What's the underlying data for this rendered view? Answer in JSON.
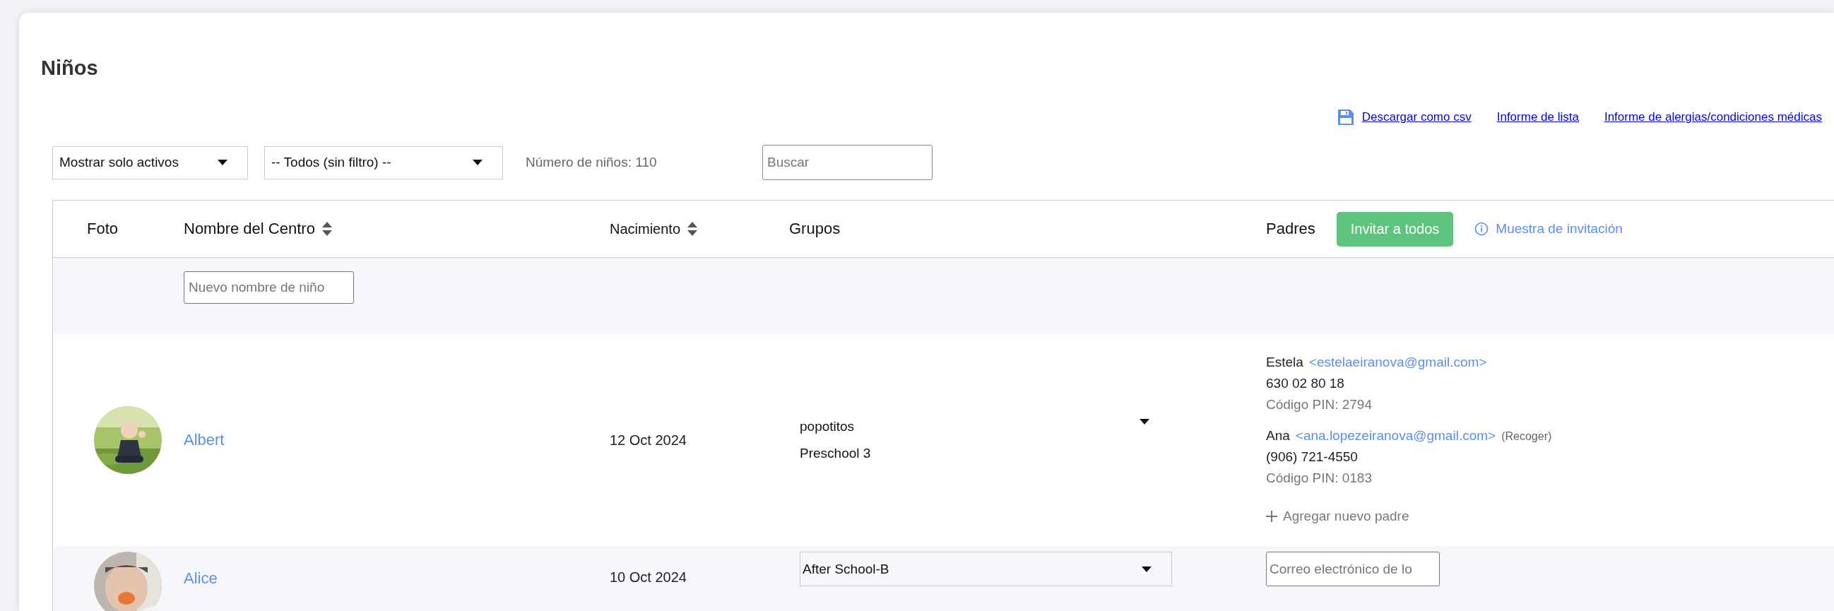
{
  "title": "Niños",
  "links": [
    {
      "label": "Descargar como csv"
    },
    {
      "label": "Informe de lista"
    },
    {
      "label": "Informe de alergias/condiciones médicas"
    }
  ],
  "filters": {
    "status_select": "Mostrar solo activos",
    "group_select": "-- Todos (sin filtro) --",
    "count": "Número de niños: 110",
    "search": {
      "placeholder": "Buscar"
    }
  },
  "table": {
    "columns": [
      {
        "label": "Foto",
        "sortable": false
      },
      {
        "label": "Nombre del Centro",
        "sortable": true
      },
      {
        "label": "Nacimiento",
        "sortable": true
      },
      {
        "label": "Grupos",
        "sortable": false
      },
      {
        "label": "Padres",
        "sortable": false
      }
    ],
    "invite_button": "Invitar a todos",
    "invite_sample": "Muestra de invitación",
    "new_child": {
      "placeholder": "Nuevo nombre de niño"
    },
    "rows": [
      {
        "name": "Albert",
        "birth": "12 Oct 2024",
        "groups": {
          "kind": "list",
          "items": [
            "popotitos",
            "Preschool 3"
          ]
        },
        "parents": {
          "kind": "list",
          "items": [
            {
              "name": "Estela",
              "email": "<estelaeiranova@gmail.com>",
              "phone": "630 02 80 18",
              "pin": "Código PIN: 2794"
            },
            {
              "name": "Ana",
              "email": "<ana.lopezeiranova@gmail.com>",
              "tag": "(Recoger)",
              "phone": "(906) 721-4550",
              "pin": "Código PIN: 0183"
            }
          ],
          "add": "Agregar nuevo padre"
        }
      },
      {
        "name": "Alice",
        "birth": "10 Oct 2024",
        "groups": {
          "kind": "select",
          "value": "After School-B"
        },
        "parents": {
          "kind": "input",
          "placeholder": "Correo electrónico de lo"
        }
      }
    ]
  }
}
